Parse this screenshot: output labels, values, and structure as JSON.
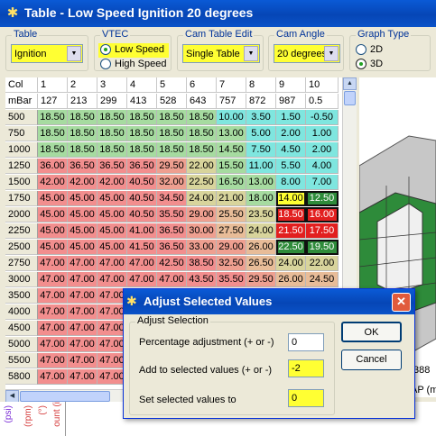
{
  "window": {
    "title": "Table - Low Speed Ignition 20 degrees"
  },
  "controls": {
    "table": {
      "label": "Table",
      "value": "Ignition"
    },
    "vtec": {
      "label": "VTEC",
      "options": [
        "Low Speed",
        "High Speed"
      ],
      "selected": "Low Speed"
    },
    "cam_table_edit": {
      "label": "Cam Table Edit",
      "value": "Single Table"
    },
    "cam_angle": {
      "label": "Cam Angle",
      "value": "20 degrees"
    },
    "graph_type": {
      "label": "Graph Type",
      "options": [
        "2D",
        "3D"
      ],
      "selected": "3D"
    }
  },
  "grid": {
    "corner_col": "Col",
    "corner_mbar": "mBar",
    "cols": [
      "1",
      "2",
      "3",
      "4",
      "5",
      "6",
      "7",
      "8",
      "9",
      "10"
    ],
    "mbar": [
      "127",
      "213",
      "299",
      "413",
      "528",
      "643",
      "757",
      "872",
      "987",
      "0.5"
    ],
    "rows": [
      {
        "rpm": "500",
        "v": [
          "18.50",
          "18.50",
          "18.50",
          "18.50",
          "18.50",
          "18.50",
          "10.00",
          "3.50",
          "1.50",
          "-0.50"
        ]
      },
      {
        "rpm": "750",
        "v": [
          "18.50",
          "18.50",
          "18.50",
          "18.50",
          "18.50",
          "18.50",
          "13.00",
          "5.00",
          "2.00",
          "1.00"
        ]
      },
      {
        "rpm": "1000",
        "v": [
          "18.50",
          "18.50",
          "18.50",
          "18.50",
          "18.50",
          "18.50",
          "14.50",
          "7.50",
          "4.50",
          "2.00"
        ]
      },
      {
        "rpm": "1250",
        "v": [
          "36.00",
          "36.50",
          "36.50",
          "36.50",
          "29.50",
          "22.00",
          "15.50",
          "11.00",
          "5.50",
          "4.00"
        ]
      },
      {
        "rpm": "1500",
        "v": [
          "42.00",
          "42.00",
          "42.00",
          "40.50",
          "32.00",
          "22.50",
          "16.50",
          "13.00",
          "8.00",
          "7.00"
        ]
      },
      {
        "rpm": "1750",
        "v": [
          "45.00",
          "45.00",
          "45.00",
          "40.50",
          "34.50",
          "24.00",
          "21.00",
          "18.00",
          "14.00",
          "12.50"
        ]
      },
      {
        "rpm": "2000",
        "v": [
          "45.00",
          "45.00",
          "45.00",
          "40.50",
          "35.50",
          "29.00",
          "25.50",
          "23.50",
          "18.50",
          "16.00"
        ]
      },
      {
        "rpm": "2250",
        "v": [
          "45.00",
          "45.00",
          "45.00",
          "41.00",
          "36.50",
          "30.00",
          "27.50",
          "24.00",
          "21.50",
          "17.50"
        ]
      },
      {
        "rpm": "2500",
        "v": [
          "45.00",
          "45.00",
          "45.00",
          "41.50",
          "36.50",
          "33.00",
          "29.00",
          "26.00",
          "22.50",
          "19.50"
        ]
      },
      {
        "rpm": "2750",
        "v": [
          "47.00",
          "47.00",
          "47.00",
          "47.00",
          "42.50",
          "38.50",
          "32.50",
          "26.50",
          "24.00",
          "22.00"
        ]
      },
      {
        "rpm": "3000",
        "v": [
          "47.00",
          "47.00",
          "47.00",
          "47.00",
          "47.00",
          "43.50",
          "35.50",
          "29.50",
          "26.00",
          "24.50"
        ]
      },
      {
        "rpm": "3500",
        "v": [
          "47.00",
          "47.00",
          "47.00",
          "",
          "",
          "",
          "",
          "",
          "",
          ""
        ]
      },
      {
        "rpm": "4000",
        "v": [
          "47.00",
          "47.00",
          "47.00",
          "",
          "",
          "",
          "",
          "",
          "",
          ""
        ]
      },
      {
        "rpm": "4500",
        "v": [
          "47.00",
          "47.00",
          "47.00",
          "",
          "",
          "",
          "",
          "",
          "",
          ""
        ]
      },
      {
        "rpm": "5000",
        "v": [
          "47.00",
          "47.00",
          "47.00",
          "",
          "",
          "",
          "",
          "",
          "",
          ""
        ]
      },
      {
        "rpm": "5500",
        "v": [
          "47.00",
          "47.00",
          "47.00",
          "",
          "",
          "",
          "",
          "",
          "",
          ""
        ]
      },
      {
        "rpm": "5800",
        "v": [
          "47.00",
          "47.00",
          "47.00",
          "",
          "",
          "",
          "",
          "",
          "",
          ""
        ]
      }
    ]
  },
  "graph": {
    "tick_label": "388",
    "axis_label": "AP (m"
  },
  "bottom_strip": {
    "labels": [
      "(psi)",
      "(rpm)",
      "(°)",
      "ount (i"
    ]
  },
  "dialog": {
    "title": "Adjust Selected Values",
    "group_label": "Adjust Selection",
    "fields": [
      {
        "label": "Percentage adjustment (+ or -)",
        "value": "0"
      },
      {
        "label": "Add to selected values (+ or -)",
        "value": "-2"
      },
      {
        "label": "Set selected values to",
        "value": "0"
      }
    ],
    "ok": "OK",
    "cancel": "Cancel"
  },
  "colors": {
    "highlight": "#ffff33",
    "title_blue": "#0646b6"
  }
}
